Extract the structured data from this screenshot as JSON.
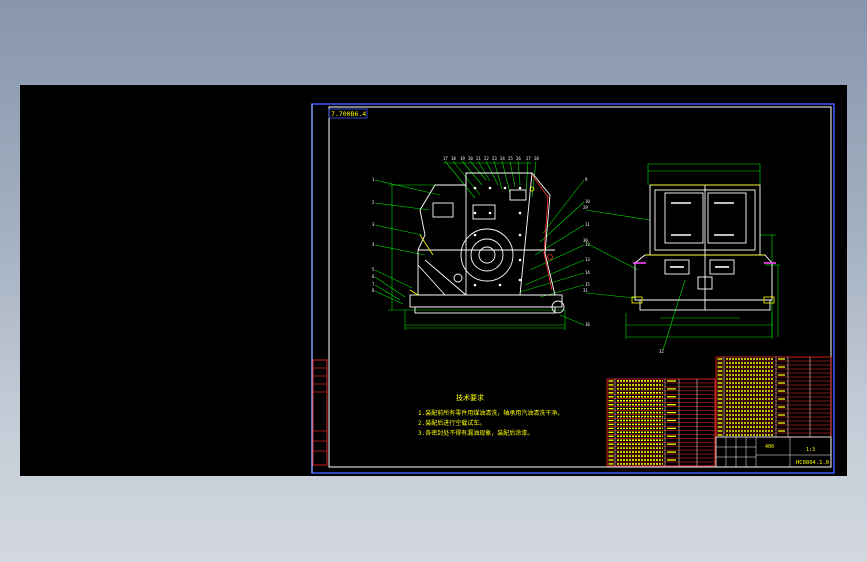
{
  "drawing": {
    "corner_tag": "7.700B6.4",
    "drawing_number": "HC0804.1.0",
    "title_block_code": "400",
    "title_block_scale": "1:3",
    "technical_requirements_heading": "技术要求",
    "technical_requirements": [
      "1.装配前所有零件用煤油清洗，轴承用汽油清洗干净。",
      "2.装配后进行空载试车。",
      "3.各密封处不得有漏油现象，装配后涂漆。"
    ]
  },
  "colors": {
    "background": "#000000",
    "frame": "#3b5bff",
    "geometry": "#ffffff",
    "leaders": "#00e000",
    "text": "#ffff00",
    "table_grid": "#ff2a2a",
    "hatch_red": "#ff3030",
    "magenta": "#ff40ff"
  }
}
